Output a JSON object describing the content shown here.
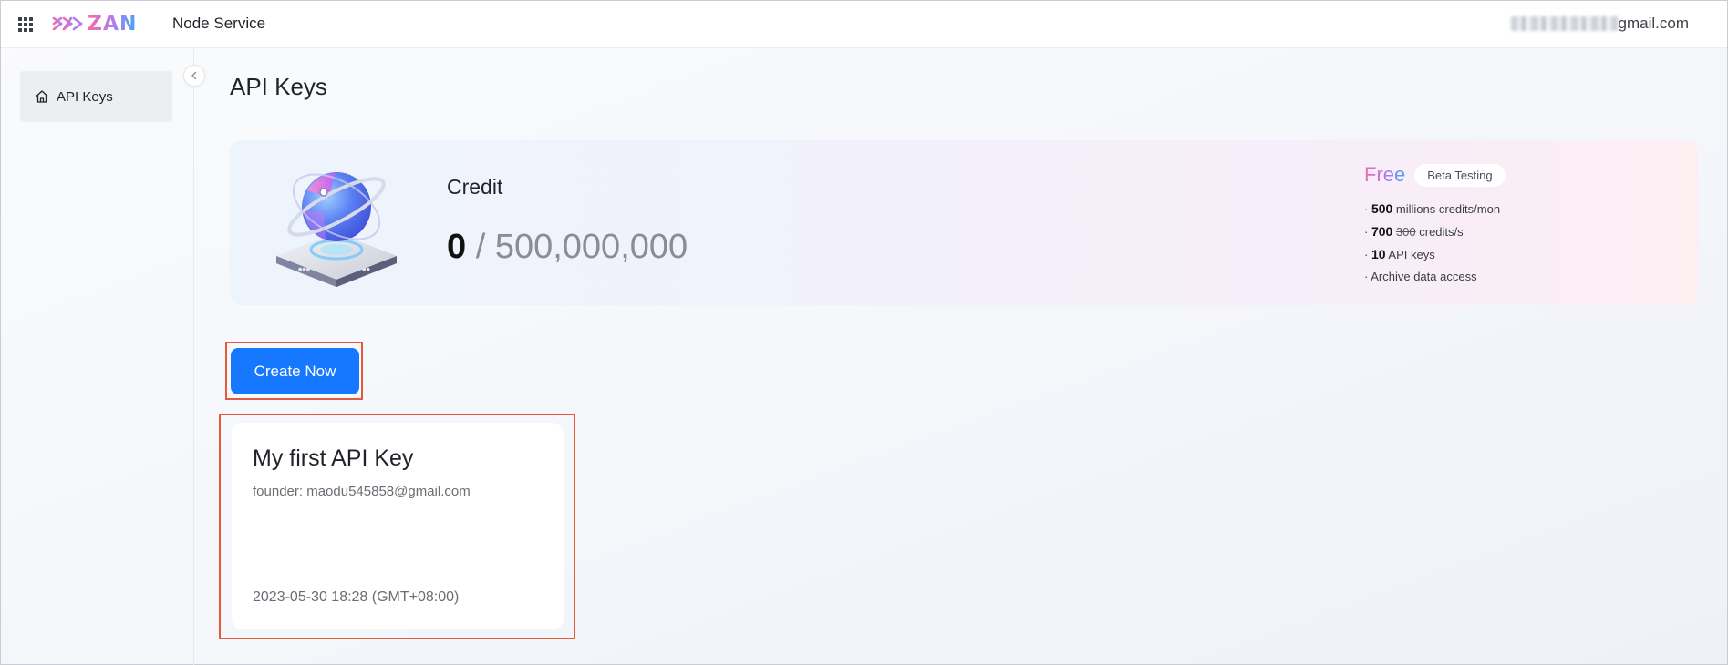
{
  "header": {
    "apps_icon": "grid-icon",
    "logo_text": "ZAN",
    "app_title": "Node Service",
    "user_email_suffix": "gmail.com"
  },
  "sidebar": {
    "items": [
      {
        "label": "API Keys",
        "icon": "home-icon"
      }
    ],
    "collapse_icon": "chevron-left-icon"
  },
  "main": {
    "page_title": "API Keys",
    "credit": {
      "label": "Credit",
      "used": "0",
      "separator": "/",
      "total": "500,000,000"
    },
    "plan": {
      "name": "Free",
      "badge": "Beta Testing",
      "features": [
        {
          "prefix": "· ",
          "bold": "500",
          "text": " millions credits/mon"
        },
        {
          "prefix": "· ",
          "bold": "700",
          "strike": "300",
          "text": " credits/s"
        },
        {
          "prefix": "· ",
          "bold": "10",
          "text": " API keys"
        },
        {
          "prefix": "· ",
          "text": "Archive data access"
        }
      ]
    },
    "create_button": "Create Now",
    "api_keys": [
      {
        "name": "My first API Key",
        "founder": "founder: maodu545858@gmail.com",
        "created": "2023-05-30 18:28 (GMT+08:00)"
      }
    ]
  },
  "colors": {
    "primary": "#1677ff",
    "highlight": "#e55a3a",
    "brand_pink": "#f36aa6",
    "brand_blue": "#46a5f5"
  }
}
